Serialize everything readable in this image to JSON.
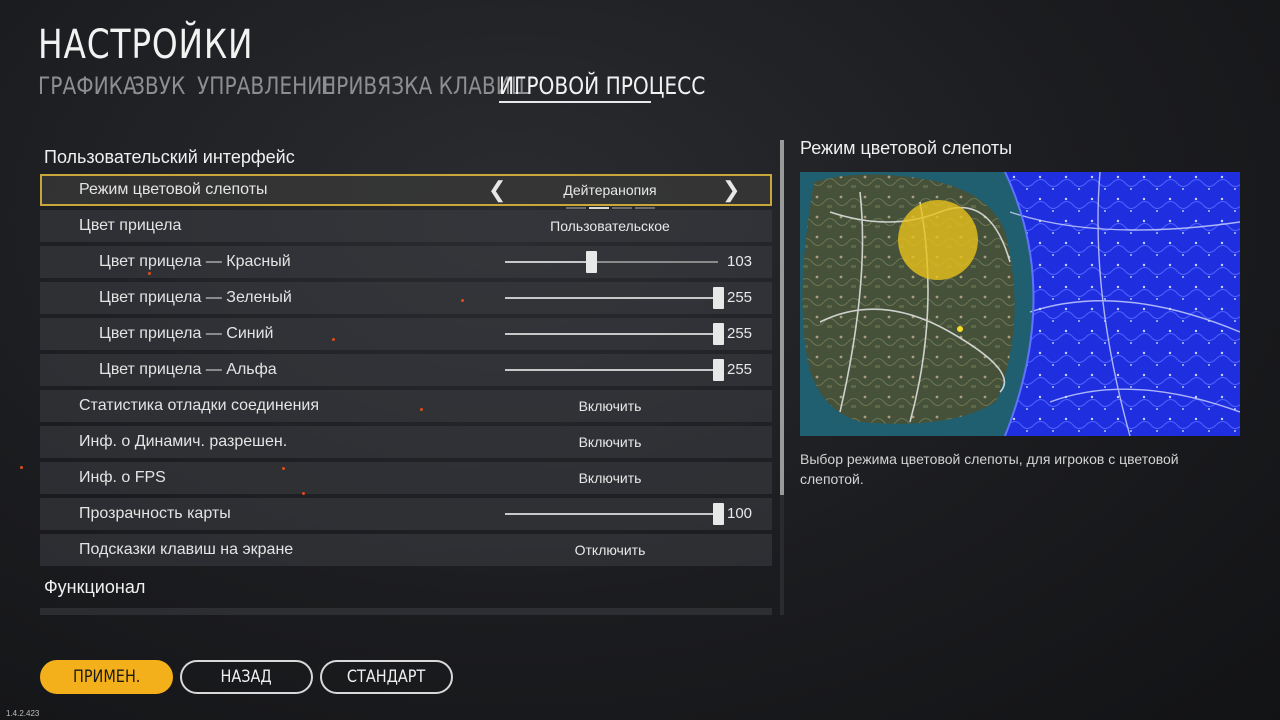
{
  "title": "НАСТРОЙКИ",
  "tabs": [
    {
      "label": "ГРАФИКА"
    },
    {
      "label": "ЗВУК"
    },
    {
      "label": "УПРАВЛЕНИЕ"
    },
    {
      "label": "ПРИВЯЗКА КЛАВИШ"
    },
    {
      "label": "ИГРОВОЙ ПРОЦЕСС"
    }
  ],
  "active_tab": "ИГРОВОЙ ПРОЦЕСС",
  "sections": {
    "ui": "Пользовательский интерфейс",
    "func": "Функционал"
  },
  "rows": {
    "colorblind": {
      "label": "Режим цветовой слепоты",
      "value": "Дейтеранопия",
      "option_index": 2,
      "option_count": 4
    },
    "crosshair_color": {
      "label": "Цвет прицела",
      "value": "Пользовательское"
    },
    "crosshair_red": {
      "label": "Цвет прицела — Красный",
      "value": "103",
      "max": 255
    },
    "crosshair_green": {
      "label": "Цвет прицела — Зеленый",
      "value": "255",
      "max": 255
    },
    "crosshair_blue": {
      "label": "Цвет прицела — Синий",
      "value": "255",
      "max": 255
    },
    "crosshair_alpha": {
      "label": "Цвет прицела — Альфа",
      "value": "255",
      "max": 255
    },
    "net_debug": {
      "label": "Статистика отладки соединения",
      "value": "Включить"
    },
    "dyn_res": {
      "label": "Инф. о Динамич. разрешен.",
      "value": "Включить"
    },
    "fps": {
      "label": "Инф. о FPS",
      "value": "Включить"
    },
    "map_opacity": {
      "label": "Прозрачность карты",
      "value": "100",
      "max": 100
    },
    "key_hints": {
      "label": "Подсказки клавиш на экране",
      "value": "Отключить"
    }
  },
  "preview": {
    "title": "Режим цветовой слепоты",
    "description": "Выбор режима цветовой слепоты, для игроков с цветовой слепотой."
  },
  "buttons": {
    "apply": "ПРИМЕН.",
    "back": "НАЗАД",
    "default": "СТАНДАРТ"
  },
  "version": "1.4.2.423",
  "colors": {
    "accent": "#f3b01b",
    "selection_border": "#c9a63a",
    "colorblind_blue": "#1a2bd8",
    "zone_yellow": "#e8c21c"
  }
}
